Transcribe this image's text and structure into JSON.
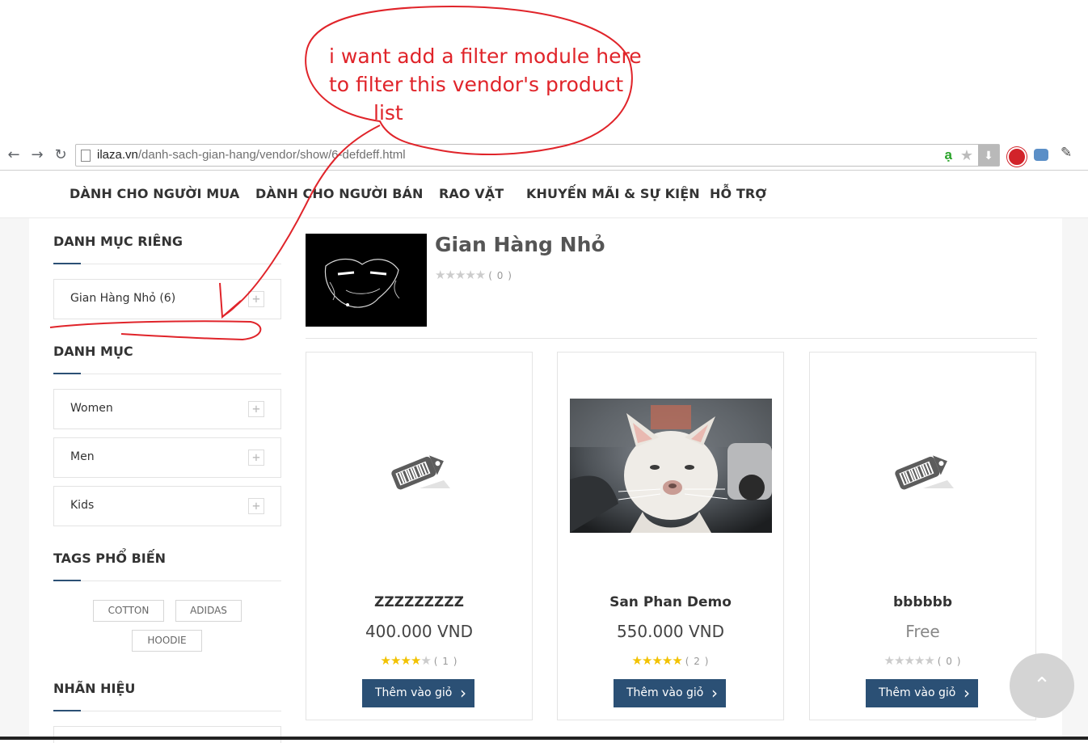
{
  "annotation": {
    "lines": [
      "i want add a filter module here",
      "to filter this vendor's product",
      "list"
    ],
    "color": "#e0242a"
  },
  "browser": {
    "url_domain": "ilaza.vn",
    "url_path": "/danh-sach-gian-hang/vendor/show/6-defdeff.html",
    "addon_letter": "ạ"
  },
  "nav": {
    "items": [
      "DÀNH CHO NGƯỜI MUA",
      "DÀNH CHO NGƯỜI BÁN",
      "RAO VẶT",
      "KHUYẾN MÃI & SỰ KIỆN",
      "HỖ TRỢ"
    ]
  },
  "sidebar": {
    "private_title": "DANH MỤC RIÊNG",
    "private_items": [
      {
        "label": "Gian Hàng Nhỏ (6)"
      }
    ],
    "category_title": "DANH MỤC",
    "categories": [
      {
        "label": "Women"
      },
      {
        "label": "Men"
      },
      {
        "label": "Kids"
      }
    ],
    "tags_title": "TAGS PHỔ BIẾN",
    "tags": [
      "COTTON",
      "ADIDAS",
      "HOODIE"
    ],
    "brand_title": "NHÃN HIỆU"
  },
  "vendor": {
    "name": "Gian Hàng Nhỏ",
    "rating": 0,
    "rating_count": "( 0 )"
  },
  "products": [
    {
      "name": "ZZZZZZZZZ",
      "price": "400.000 VND",
      "rating": 4,
      "rating_count": "( 1 )",
      "button": "Thêm vào giỏ",
      "image": "placeholder-tag"
    },
    {
      "name": "San Phan Demo",
      "price": "550.000 VND",
      "rating": 5,
      "rating_count": "( 2 )",
      "button": "Thêm vào giỏ",
      "image": "cat-photo"
    },
    {
      "name": "bbbbbb",
      "price": "Free",
      "rating": 0,
      "rating_count": "( 0 )",
      "button": "Thêm vào giỏ",
      "image": "placeholder-tag"
    }
  ],
  "colors": {
    "brand": "#2b5075",
    "star_on": "#f2c200",
    "star_off": "#cccccc"
  }
}
